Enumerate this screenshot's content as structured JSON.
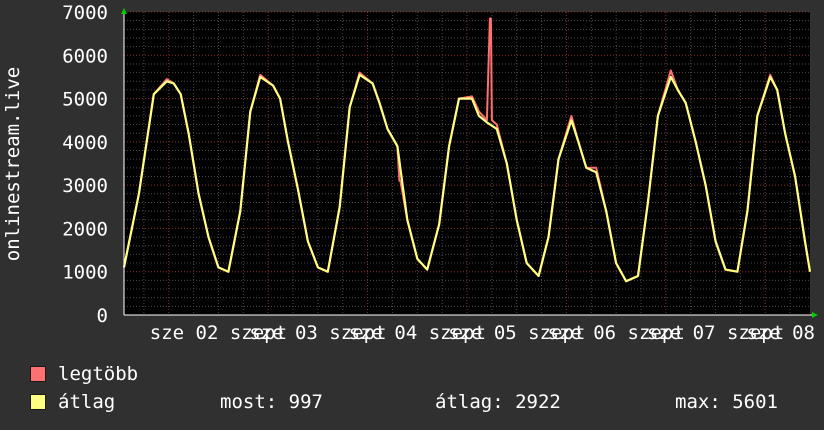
{
  "chart_data": {
    "type": "area",
    "ylabel": "onlinestream.live",
    "ylim": [
      0,
      7000
    ],
    "y_ticks": [
      0,
      1000,
      2000,
      3000,
      4000,
      5000,
      6000,
      7000
    ],
    "x_tick_labels": [
      "sze 02 szept",
      "sze 03 szept",
      "sze 04 szept",
      "sze 05 szept",
      "sze 06 szept",
      "sze 07 szept",
      "sze 08 szept"
    ],
    "x_range_days": [
      0.55,
      7.45
    ],
    "grid": true,
    "series": [
      {
        "name": "legtöbb",
        "color": "#ff7070",
        "x": [
          0.55,
          0.7,
          0.85,
          0.98,
          1.05,
          1.12,
          1.2,
          1.3,
          1.4,
          1.5,
          1.6,
          1.72,
          1.82,
          1.92,
          2.05,
          2.12,
          2.2,
          2.3,
          2.4,
          2.5,
          2.6,
          2.72,
          2.82,
          2.92,
          3.05,
          3.12,
          3.2,
          3.3,
          3.32,
          3.33,
          3.4,
          3.5,
          3.6,
          3.72,
          3.82,
          3.92,
          4.05,
          4.12,
          4.2,
          4.23,
          4.24,
          4.25,
          4.3,
          4.4,
          4.5,
          4.6,
          4.72,
          4.82,
          4.92,
          5.05,
          5.12,
          5.2,
          5.3,
          5.4,
          5.5,
          5.6,
          5.72,
          5.82,
          5.92,
          6.05,
          6.12,
          6.2,
          6.3,
          6.4,
          6.5,
          6.6,
          6.72,
          6.82,
          6.92,
          7.05,
          7.12,
          7.2,
          7.3,
          7.4,
          7.45
        ],
        "values": [
          1100,
          2800,
          5100,
          5450,
          5350,
          5100,
          4200,
          2800,
          1800,
          1100,
          1000,
          2400,
          4700,
          5550,
          5300,
          5000,
          4000,
          2900,
          1700,
          1100,
          1000,
          2500,
          4800,
          5600,
          5350,
          4900,
          4300,
          3900,
          3100,
          3100,
          2200,
          1300,
          1050,
          2100,
          3900,
          5000,
          5050,
          4700,
          4500,
          6850,
          6850,
          4500,
          4400,
          3500,
          2200,
          1200,
          900,
          1800,
          3600,
          4600,
          4000,
          3400,
          3400,
          2400,
          1200,
          780,
          900,
          2600,
          4600,
          5650,
          5200,
          4900,
          4000,
          3000,
          1700,
          1050,
          1000,
          2400,
          4600,
          5550,
          5200,
          4200,
          3200,
          1700,
          1000
        ]
      },
      {
        "name": "átlag",
        "color": "#ffff80",
        "x": [
          0.55,
          0.7,
          0.85,
          0.98,
          1.05,
          1.12,
          1.2,
          1.3,
          1.4,
          1.5,
          1.6,
          1.72,
          1.82,
          1.92,
          2.05,
          2.12,
          2.2,
          2.3,
          2.4,
          2.5,
          2.6,
          2.72,
          2.82,
          2.92,
          3.05,
          3.12,
          3.2,
          3.3,
          3.4,
          3.5,
          3.6,
          3.72,
          3.82,
          3.92,
          4.05,
          4.12,
          4.2,
          4.3,
          4.4,
          4.5,
          4.6,
          4.72,
          4.82,
          4.92,
          5.05,
          5.12,
          5.2,
          5.3,
          5.4,
          5.5,
          5.6,
          5.72,
          5.82,
          5.92,
          6.05,
          6.12,
          6.2,
          6.3,
          6.4,
          6.5,
          6.6,
          6.72,
          6.82,
          6.92,
          7.05,
          7.12,
          7.2,
          7.3,
          7.4,
          7.45
        ],
        "values": [
          1100,
          2800,
          5100,
          5400,
          5350,
          5100,
          4200,
          2800,
          1800,
          1100,
          1000,
          2400,
          4700,
          5500,
          5300,
          5000,
          4000,
          2900,
          1700,
          1100,
          1000,
          2500,
          4800,
          5550,
          5350,
          4900,
          4300,
          3900,
          2200,
          1300,
          1050,
          2100,
          3900,
          5000,
          5000,
          4600,
          4450,
          4300,
          3500,
          2200,
          1200,
          900,
          1800,
          3600,
          4500,
          4000,
          3400,
          3300,
          2400,
          1200,
          780,
          900,
          2600,
          4600,
          5500,
          5200,
          4900,
          4000,
          3000,
          1700,
          1050,
          1000,
          2400,
          4600,
          5500,
          5200,
          4200,
          3200,
          1700,
          1000
        ]
      }
    ]
  },
  "legend": [
    {
      "label": "legtöbb",
      "color": "#ff7070"
    },
    {
      "label": "átlag",
      "color": "#ffff80"
    }
  ],
  "stats": {
    "most": "most: 997",
    "atlag": "átlag: 2922",
    "max": "max: 5601"
  }
}
